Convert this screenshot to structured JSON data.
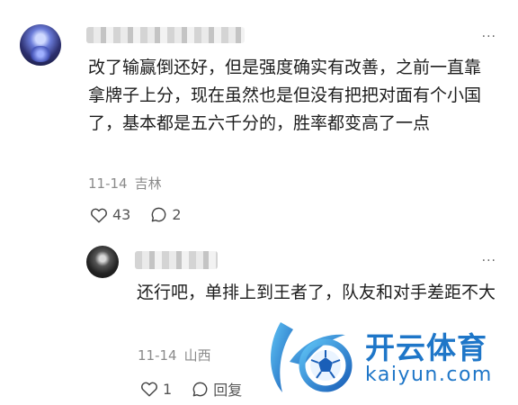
{
  "main_comment": {
    "text": "改了输赢倒还好，但是强度确实有改善，之前一直靠拿牌子上分，现在虽然也是但没有把把对面有个小国了，基本都是五六千分的，胜率都变高了一点",
    "date": "11-14",
    "location": "吉林",
    "likes": "43",
    "replies": "2",
    "more_label": "···"
  },
  "reply": {
    "text": "还行吧，单排上到王者了，队友和对手差距不大",
    "date": "11-14",
    "location": "山西",
    "likes": "1",
    "reply_label": "回复",
    "more_label": "···"
  },
  "watermark": {
    "brand": "开云体育",
    "domain": "kaiyun.com"
  },
  "colors": {
    "brand_blue": "#1e76c8",
    "text": "#1d1d1d",
    "meta": "#8a8a8a"
  }
}
